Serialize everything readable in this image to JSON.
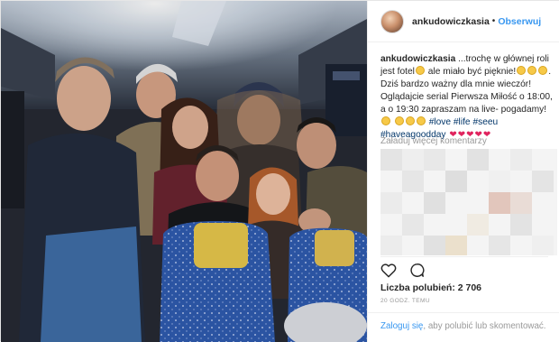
{
  "post": {
    "username": "ankudowiczkasia",
    "separator": "•",
    "follow_label": "Obserwuj",
    "caption": {
      "username": "ankudowiczkasia",
      "part1": " ...trochę w głównej roli jest fotel",
      "part2": " ale miało być pięknie!",
      "part3": ". Dziś bardzo ważny dla mnie wieczór! Oglądajcie serial Pierwsza Miłość o 18:00, a o 19:30 zapraszam na live- pogadamy!",
      "hashtags": [
        "#love",
        "#life",
        "#seeu",
        "#haveagoodday"
      ]
    },
    "load_more": "Załaduj więcej komentarzy",
    "likes_text": "Liczba polubień: 2 706",
    "time_ago": "20 GODZ. TEMU",
    "login_link": "Zaloguj się",
    "login_rest": ", aby polubić lub skomentować."
  },
  "icons": {
    "avatar": "profile-avatar",
    "like": "heart-outline-icon",
    "comment": "comment-bubble-icon",
    "emoji": "smiley-emoji-icon",
    "heart_emoji": "red-heart-icon"
  },
  "colors": {
    "link_blue": "#3897f0",
    "hashtag": "#003569",
    "muted": "#999999",
    "text": "#262626",
    "heart": "#e0245e"
  }
}
